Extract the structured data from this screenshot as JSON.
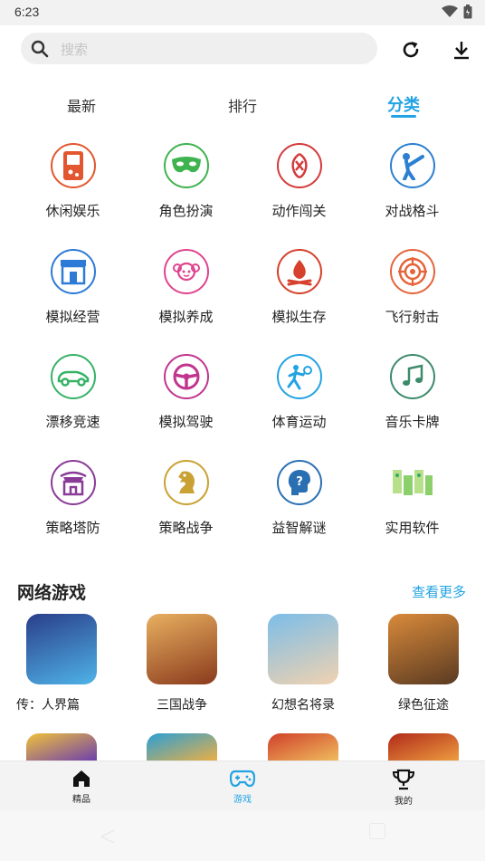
{
  "status": {
    "time": "6:23"
  },
  "search": {
    "placeholder": "搜索"
  },
  "tabs": [
    {
      "label": "最新"
    },
    {
      "label": "排行"
    },
    {
      "label": "分类"
    }
  ],
  "categories": [
    {
      "label": "休闲娱乐",
      "icon": "gameboy-icon",
      "color": "#e2572f"
    },
    {
      "label": "角色扮演",
      "icon": "mask-icon",
      "color": "#3fb34f"
    },
    {
      "label": "动作闯关",
      "icon": "action-icon",
      "color": "#d43a3a"
    },
    {
      "label": "对战格斗",
      "icon": "kick-icon",
      "color": "#2c7fd1"
    },
    {
      "label": "模拟经营",
      "icon": "shop-icon",
      "color": "#2d7bd6"
    },
    {
      "label": "模拟养成",
      "icon": "girl-icon",
      "color": "#e0448f"
    },
    {
      "label": "模拟生存",
      "icon": "campfire-icon",
      "color": "#d6402c"
    },
    {
      "label": "飞行射击",
      "icon": "target-icon",
      "color": "#e5643a"
    },
    {
      "label": "漂移竞速",
      "icon": "race-car-icon",
      "color": "#36b267"
    },
    {
      "label": "模拟驾驶",
      "icon": "steering-wheel-icon",
      "color": "#c1358f"
    },
    {
      "label": "体育运动",
      "icon": "tennis-player-icon",
      "color": "#23a3e3"
    },
    {
      "label": "音乐卡牌",
      "icon": "music-note-icon",
      "color": "#3d8a6b"
    },
    {
      "label": "策略塔防",
      "icon": "tower-icon",
      "color": "#8a3b97"
    },
    {
      "label": "策略战争",
      "icon": "chess-knight-icon",
      "color": "#c9a233"
    },
    {
      "label": "益智解谜",
      "icon": "brain-icon",
      "color": "#2b6fb3"
    },
    {
      "label": "实用软件",
      "icon": "tools-icon",
      "color": "#8bd06b"
    }
  ],
  "section": {
    "title": "网络游戏",
    "more": "查看更多"
  },
  "games": [
    {
      "label": "传：人界篇",
      "icon": "game-cover-icon",
      "colors": [
        "#2a3e8a",
        "#4fb3e8"
      ]
    },
    {
      "label": "三国战争",
      "icon": "game-cover-icon",
      "colors": [
        "#8a3a1c",
        "#e8b060"
      ]
    },
    {
      "label": "幻想名将录",
      "icon": "game-cover-icon",
      "colors": [
        "#7cbde8",
        "#f0d2b0"
      ]
    },
    {
      "label": "绿色征途",
      "icon": "game-cover-icon",
      "colors": [
        "#5a3a22",
        "#d98a3a"
      ]
    }
  ],
  "games_row2": [
    {
      "icon": "game-cover-icon",
      "colors": [
        "#f0c23a",
        "#6a3bb0"
      ]
    },
    {
      "icon": "game-cover-icon",
      "colors": [
        "#2a9fd6",
        "#f0b040"
      ]
    },
    {
      "icon": "game-cover-icon",
      "colors": [
        "#d0402a",
        "#f0c060"
      ]
    },
    {
      "icon": "game-cover-icon",
      "colors": [
        "#b02a1a",
        "#f0a040"
      ]
    }
  ],
  "bottom_nav": [
    {
      "label": "精品",
      "icon": "home-icon"
    },
    {
      "label": "游戏",
      "icon": "gamepad-icon"
    },
    {
      "label": "我的",
      "icon": "trophy-icon"
    }
  ],
  "colors": {
    "accent": "#23a3e3"
  }
}
